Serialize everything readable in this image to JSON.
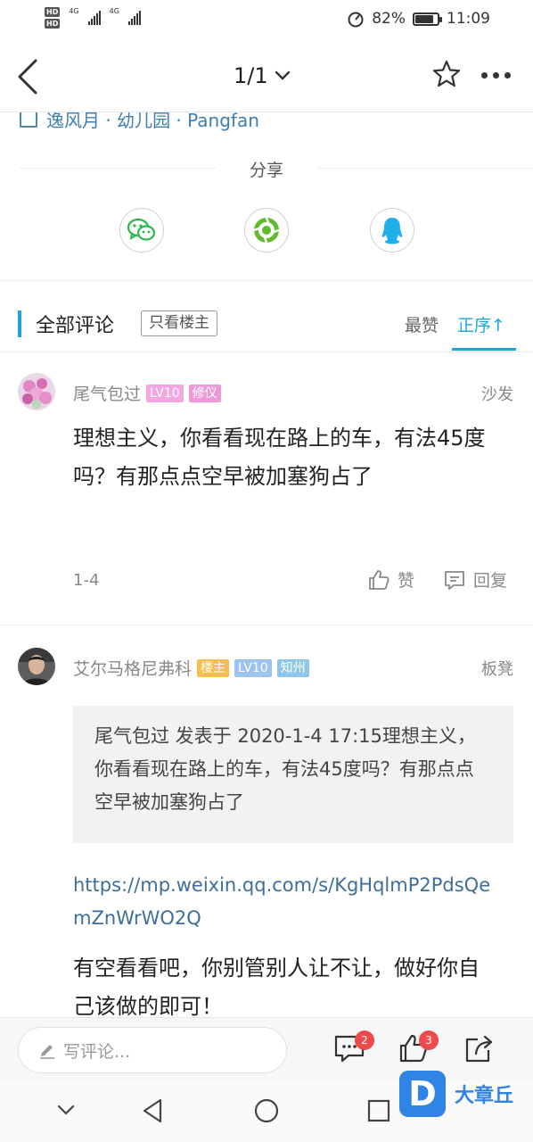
{
  "status_bar": {
    "hd1": "HD",
    "hd2": "HD",
    "net1": "4G",
    "net2": "4G",
    "battery_percent": "82%",
    "battery_level": 0.82,
    "time": "11:09"
  },
  "nav": {
    "page_indicator": "1/1"
  },
  "post_tags": "逸风月 · 幼儿园 · Pangfan",
  "share": {
    "title": "分享",
    "buttons": [
      {
        "name": "wechat",
        "icon": "wechat-icon",
        "color": "#2ab84a"
      },
      {
        "name": "moments",
        "icon": "moments-icon",
        "color": "#62bb2f"
      },
      {
        "name": "qq",
        "icon": "qq-icon",
        "color": "#1fb0ea"
      }
    ]
  },
  "comments_header": {
    "title": "全部评论",
    "only_owner": "只看楼主",
    "sort_hot": "最赞",
    "sort_asc": "正序",
    "sort_asc_arrow": "↑"
  },
  "comments": [
    {
      "username": "尾气包过",
      "badges": [
        "LV10",
        "修仪"
      ],
      "floor": "沙发",
      "text": "理想主义，你看看现在路上的车，有法45度吗？有那点点空早被加塞狗占了",
      "date": "1-4",
      "like_label": "赞",
      "reply_label": "回复"
    },
    {
      "username": "艾尔马格尼弗科",
      "badges": [
        "楼主",
        "LV10",
        "知州"
      ],
      "floor": "板凳",
      "quote": "尾气包过 发表于 2020-1-4 17:15理想主义，你看看现在路上的车，有法45度吗？有那点点空早被加塞狗占了",
      "link": "https://mp.weixin.qq.com/s/KgHqlmP2PdsQemZnWrWO2Q",
      "text": "有空看看吧，你别管别人让不让，做好你自己该做的即可！"
    }
  ],
  "bottom_bar": {
    "write_placeholder": "写评论...",
    "comment_count": "2",
    "like_count": "3"
  },
  "watermark": {
    "logo_letter": "D",
    "text": "大章丘"
  },
  "colors": {
    "accent": "#1ea6d8",
    "link": "#3d6e9a",
    "badge_red": "#ee4a4a"
  }
}
